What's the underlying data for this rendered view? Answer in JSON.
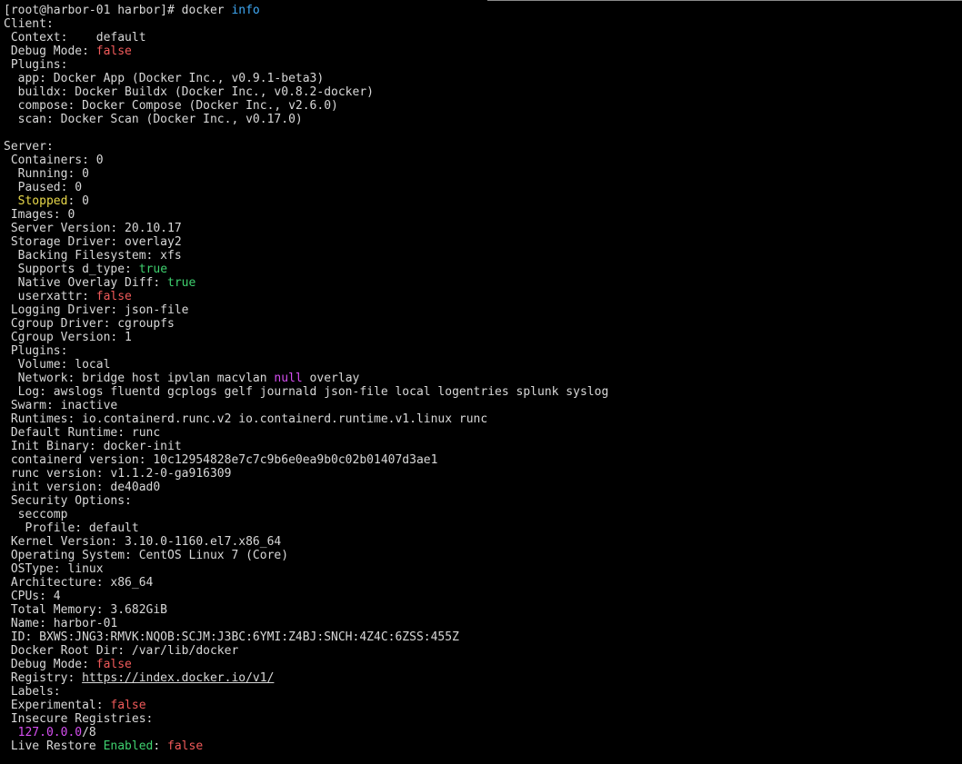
{
  "colors": {
    "background": "#000000",
    "text": "#d8d8d8",
    "command": "#3fa9f5",
    "false": "#f05a5a",
    "true": "#3fd16f",
    "stopped": "#e8d84a",
    "null": "#d54ef0"
  },
  "lines": [
    [
      {
        "t": "[root@harbor-01 harbor]# docker "
      },
      {
        "t": "info",
        "c": "blue"
      }
    ],
    [
      {
        "t": "Client:"
      }
    ],
    [
      {
        "t": " Context:    default"
      }
    ],
    [
      {
        "t": " Debug Mode: "
      },
      {
        "t": "false",
        "c": "red"
      }
    ],
    [
      {
        "t": " Plugins:"
      }
    ],
    [
      {
        "t": "  app: Docker App (Docker Inc., v0.9.1-beta3)"
      }
    ],
    [
      {
        "t": "  buildx: Docker Buildx (Docker Inc., v0.8.2-docker)"
      }
    ],
    [
      {
        "t": "  compose: Docker Compose (Docker Inc., v2.6.0)"
      }
    ],
    [
      {
        "t": "  scan: Docker Scan (Docker Inc., v0.17.0)"
      }
    ],
    [
      {
        "t": ""
      }
    ],
    [
      {
        "t": "Server:"
      }
    ],
    [
      {
        "t": " Containers: 0"
      }
    ],
    [
      {
        "t": "  Running: 0"
      }
    ],
    [
      {
        "t": "  Paused: 0"
      }
    ],
    [
      {
        "t": "  "
      },
      {
        "t": "Stopped",
        "c": "yellow"
      },
      {
        "t": ": 0"
      }
    ],
    [
      {
        "t": " Images: 0"
      }
    ],
    [
      {
        "t": " Server Version: 20.10.17"
      }
    ],
    [
      {
        "t": " Storage Driver: overlay2"
      }
    ],
    [
      {
        "t": "  Backing Filesystem: xfs"
      }
    ],
    [
      {
        "t": "  Supports d_type: "
      },
      {
        "t": "true",
        "c": "green"
      }
    ],
    [
      {
        "t": "  Native Overlay Diff: "
      },
      {
        "t": "true",
        "c": "green"
      }
    ],
    [
      {
        "t": "  userxattr: "
      },
      {
        "t": "false",
        "c": "red"
      }
    ],
    [
      {
        "t": " Logging Driver: json-file"
      }
    ],
    [
      {
        "t": " Cgroup Driver: cgroupfs"
      }
    ],
    [
      {
        "t": " Cgroup Version: 1"
      }
    ],
    [
      {
        "t": " Plugins:"
      }
    ],
    [
      {
        "t": "  Volume: local"
      }
    ],
    [
      {
        "t": "  Network: bridge host ipvlan macvlan "
      },
      {
        "t": "null",
        "c": "magenta"
      },
      {
        "t": " overlay"
      }
    ],
    [
      {
        "t": "  Log: awslogs fluentd gcplogs gelf journald json-file local logentries splunk syslog"
      }
    ],
    [
      {
        "t": " Swarm: inactive"
      }
    ],
    [
      {
        "t": " Runtimes: io.containerd.runc.v2 io.containerd.runtime.v1.linux runc"
      }
    ],
    [
      {
        "t": " Default Runtime: runc"
      }
    ],
    [
      {
        "t": " Init Binary: docker-init"
      }
    ],
    [
      {
        "t": " containerd version: 10c12954828e7c7c9b6e0ea9b0c02b01407d3ae1"
      }
    ],
    [
      {
        "t": " runc version: v1.1.2-0-ga916309"
      }
    ],
    [
      {
        "t": " init version: de40ad0"
      }
    ],
    [
      {
        "t": " Security Options:"
      }
    ],
    [
      {
        "t": "  seccomp"
      }
    ],
    [
      {
        "t": "   Profile: default"
      }
    ],
    [
      {
        "t": " Kernel Version: 3.10.0-1160.el7.x86_64"
      }
    ],
    [
      {
        "t": " Operating System: CentOS Linux 7 (Core)"
      }
    ],
    [
      {
        "t": " OSType: linux"
      }
    ],
    [
      {
        "t": " Architecture: x86_64"
      }
    ],
    [
      {
        "t": " CPUs: 4"
      }
    ],
    [
      {
        "t": " Total Memory: 3.682GiB"
      }
    ],
    [
      {
        "t": " Name: harbor-01"
      }
    ],
    [
      {
        "t": " ID: BXWS:JNG3:RMVK:NQOB:SCJM:J3BC:6YMI:Z4BJ:SNCH:4Z4C:6ZSS:455Z"
      }
    ],
    [
      {
        "t": " Docker Root Dir: /var/lib/docker"
      }
    ],
    [
      {
        "t": " Debug Mode: "
      },
      {
        "t": "false",
        "c": "red"
      }
    ],
    [
      {
        "t": " Registry: "
      },
      {
        "t": "https://index.docker.io/v1/",
        "c": "link"
      }
    ],
    [
      {
        "t": " Labels:"
      }
    ],
    [
      {
        "t": " Experimental: "
      },
      {
        "t": "false",
        "c": "red"
      }
    ],
    [
      {
        "t": " Insecure Registries:"
      }
    ],
    [
      {
        "t": "  "
      },
      {
        "t": "127.0.0.0",
        "c": "magenta"
      },
      {
        "t": "/8"
      }
    ],
    [
      {
        "t": " Live Restore "
      },
      {
        "t": "Enabled",
        "c": "green"
      },
      {
        "t": ": "
      },
      {
        "t": "false",
        "c": "red"
      }
    ]
  ]
}
